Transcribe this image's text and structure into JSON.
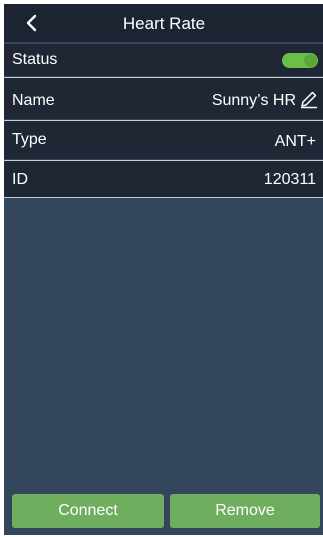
{
  "header": {
    "title": "Heart Rate",
    "back_icon": "chevron-left-icon"
  },
  "status": {
    "label": "Status",
    "enabled": true,
    "toggle_color": "#6bbf47"
  },
  "name": {
    "label": "Name",
    "value": "Sunny’s HR",
    "edit_icon": "pencil-icon"
  },
  "type": {
    "label": "Type",
    "value": "ANT+"
  },
  "id": {
    "label": "ID",
    "value": "120311"
  },
  "actions": {
    "connect_label": "Connect",
    "remove_label": "Remove",
    "button_color": "#6fae5f"
  },
  "colors": {
    "background": "#33465c",
    "row_background": "#1f2735",
    "titlebar_background": "#1c2431"
  }
}
